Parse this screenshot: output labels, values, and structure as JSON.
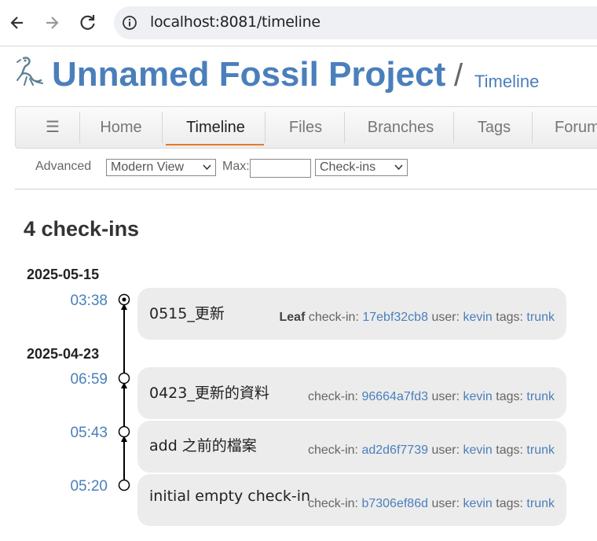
{
  "browser": {
    "url": "localhost:8081/timeline",
    "back_icon": "arrow-left-icon",
    "forward_icon": "arrow-right-icon",
    "reload_icon": "reload-icon",
    "site_info_icon": "info-icon"
  },
  "header": {
    "logo_icon": "fossil-logo-icon",
    "project_title": "Unnamed Fossil Project",
    "separator": "/",
    "page_title": "Timeline"
  },
  "menu": {
    "hamburger": "☰",
    "items": [
      "Home",
      "Timeline",
      "Files",
      "Branches",
      "Tags",
      "Forum"
    ],
    "active": "Timeline"
  },
  "submenu": {
    "advanced_label": "Advanced",
    "view_select": "Modern View",
    "max_label": "Max:",
    "max_value": "",
    "type_select": "Check-ins"
  },
  "timeline": {
    "heading": "4 check-ins",
    "dates": [
      "2025-05-15",
      "2025-04-23"
    ],
    "entries": [
      {
        "time": "03:38",
        "comment": "0515_更新",
        "leaf_label": "Leaf",
        "checkin_label": "check-in:",
        "hash": "17ebf32cb8",
        "user_label": "user:",
        "user": "kevin",
        "tags_label": "tags:",
        "tag": "trunk"
      },
      {
        "time": "06:59",
        "comment": "0423_更新的資料",
        "leaf_label": "",
        "checkin_label": "check-in:",
        "hash": "96664a7fd3",
        "user_label": "user:",
        "user": "kevin",
        "tags_label": "tags:",
        "tag": "trunk"
      },
      {
        "time": "05:43",
        "comment": "add 之前的檔案",
        "leaf_label": "",
        "checkin_label": "check-in:",
        "hash": "ad2d6f7739",
        "user_label": "user:",
        "user": "kevin",
        "tags_label": "tags:",
        "tag": "trunk"
      },
      {
        "time": "05:20",
        "comment": "initial empty check-in",
        "leaf_label": "",
        "checkin_label": "check-in:",
        "hash": "b7306ef86d",
        "user_label": "user:",
        "user": "kevin",
        "tags_label": "tags:",
        "tag": "trunk"
      }
    ]
  },
  "colors": {
    "link": "#4a7fbb",
    "active_tab_underline": "#e67a28",
    "card_bg": "#ececec"
  }
}
